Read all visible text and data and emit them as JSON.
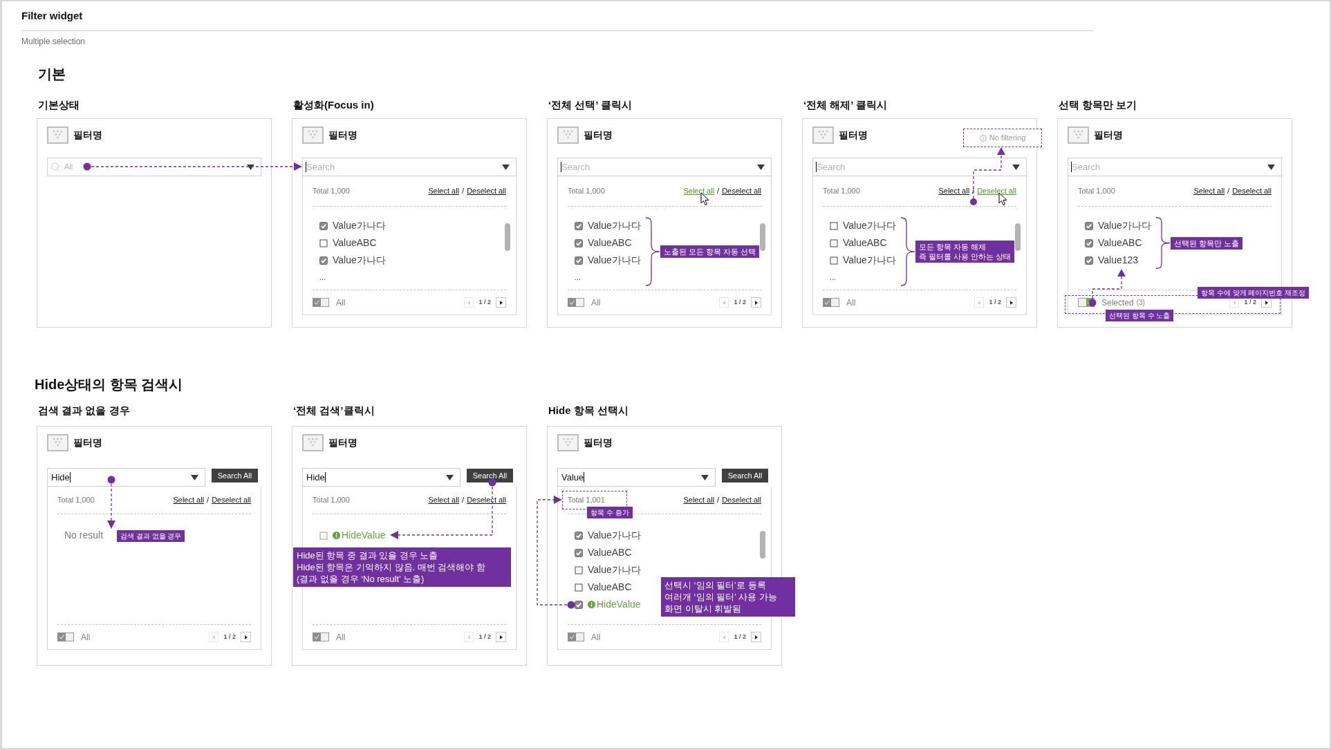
{
  "header": {
    "title": "Filter widget",
    "subtitle": "Multiple selection"
  },
  "sections": [
    {
      "title": "기본",
      "panels": [
        {
          "title": "기본상태",
          "filter_name": "필터명",
          "field": {
            "kind": "idle",
            "placeholder": "All"
          },
          "notes": [
            {
              "kind": "handoff"
            }
          ]
        },
        {
          "title": "활성화(Focus in)",
          "filter_name": "필터명",
          "field": {
            "kind": "focused",
            "placeholder": "Search"
          },
          "list": {
            "total": "Total 1,000",
            "select_all": {
              "label": "Select all",
              "clicked": false
            },
            "separator": "/",
            "deselect_all": {
              "label": "Deselect all",
              "clicked": false
            },
            "items": [
              {
                "label": "Value가나다",
                "checked": true,
                "kind": "regular"
              },
              {
                "label": "ValueABC",
                "checked": false,
                "kind": "regular"
              },
              {
                "label": "Value가나다",
                "checked": true,
                "kind": "regular"
              }
            ],
            "more": "...",
            "scrollbar": true,
            "footer": {
              "selected_only": false,
              "label": "All",
              "pager": {
                "page": "1 / 2",
                "prev_enabled": false,
                "next_enabled": true
              }
            }
          }
        },
        {
          "title": "‘전체 선택’ 클릭시",
          "filter_name": "필터명",
          "field": {
            "kind": "focused",
            "placeholder": "Search"
          },
          "list": {
            "total": "Total 1,000",
            "select_all": {
              "label": "Select all",
              "clicked": true
            },
            "separator": "/",
            "deselect_all": {
              "label": "Deselect all",
              "clicked": false
            },
            "items": [
              {
                "label": "Value가나다",
                "checked": true,
                "kind": "regular"
              },
              {
                "label": "ValueABC",
                "checked": true,
                "kind": "regular"
              },
              {
                "label": "Value가나다",
                "checked": true,
                "kind": "regular"
              }
            ],
            "more": "...",
            "scrollbar": true,
            "footer": {
              "selected_only": false,
              "label": "All",
              "pager": {
                "page": "1 / 2",
                "prev_enabled": false,
                "next_enabled": true
              }
            }
          },
          "notes": [
            {
              "kind": "brace",
              "lines": [
                "노출된 모든 항목 자동 선택"
              ]
            }
          ]
        },
        {
          "title": "‘전체 해제’ 클릭시",
          "filter_name": "필터명",
          "field": {
            "kind": "focused",
            "placeholder": "Search"
          },
          "list": {
            "total": "Total 1,000",
            "select_all": {
              "label": "Select all",
              "clicked": false
            },
            "separator": "/",
            "deselect_all": {
              "label": "Deselect all",
              "clicked": true
            },
            "items": [
              {
                "label": "Value가나다",
                "checked": false,
                "kind": "regular"
              },
              {
                "label": "ValueABC",
                "checked": false,
                "kind": "regular"
              },
              {
                "label": "Value가나다",
                "checked": false,
                "kind": "regular"
              }
            ],
            "more": "...",
            "scrollbar": true,
            "footer": {
              "selected_only": false,
              "label": "All",
              "pager": {
                "page": "1 / 2",
                "prev_enabled": false,
                "next_enabled": true
              }
            }
          },
          "notes": [
            {
              "kind": "no-filtering",
              "text": "No filtering"
            },
            {
              "kind": "brace",
              "lines": [
                "모든 항목 자동 해제",
                "즉 필터를 사용 안하는 상태"
              ]
            }
          ]
        },
        {
          "title": "선택 항목만 보기",
          "filter_name": "필터명",
          "field": {
            "kind": "focused",
            "placeholder": "Search"
          },
          "list": {
            "total": "Total 1,000",
            "select_all": {
              "label": "Select all",
              "clicked": false
            },
            "separator": "/",
            "deselect_all": {
              "label": "Deselect all",
              "clicked": false
            },
            "items": [
              {
                "label": "Value가나다",
                "checked": true,
                "kind": "regular"
              },
              {
                "label": "ValueABC",
                "checked": true,
                "kind": "regular"
              },
              {
                "label": "Value123",
                "checked": true,
                "kind": "regular"
              }
            ],
            "footer": {
              "selected_only": true,
              "label": "Selected",
              "count": "(3)",
              "pager": {
                "page": "1 / 2",
                "prev_enabled": false,
                "next_enabled": true
              }
            }
          },
          "notes": [
            {
              "kind": "brace",
              "lines": [
                "선택된 항목만 노출"
              ]
            },
            {
              "kind": "footer-count",
              "labels": [
                "항목 수에 맞게 페이지번호 재조정",
                "선택된 항목 수 노출"
              ]
            }
          ]
        }
      ]
    },
    {
      "title": "Hide상태의 항목 검색시",
      "panels": [
        {
          "title": "검색 결과 없을 경우",
          "filter_name": "필터명",
          "field": {
            "kind": "focused",
            "value": "Hide"
          },
          "search_all": "Search All",
          "list": {
            "total": "Total 1,000",
            "select_all": {
              "label": "Select all",
              "clicked": false
            },
            "separator": "/",
            "deselect_all": {
              "label": "Deselect all",
              "clicked": false
            },
            "no_result": "No result",
            "footer": {
              "selected_only": false,
              "label": "All",
              "pager": {
                "page": "1 / 2",
                "prev_enabled": false,
                "next_enabled": true
              }
            }
          },
          "notes": [
            {
              "kind": "no-result",
              "label": "검색 결과 없을 경우"
            }
          ]
        },
        {
          "title": "‘전체 검색’클릭시",
          "filter_name": "필터명",
          "field": {
            "kind": "focused",
            "value": "Hide"
          },
          "search_all": "Search All",
          "list": {
            "total": "Total 1,000",
            "select_all": {
              "label": "Select all",
              "clicked": false
            },
            "separator": "/",
            "deselect_all": {
              "label": "Deselect all",
              "clicked": false
            },
            "items": [
              {
                "label": "HideValue",
                "checked": false,
                "kind": "hidden"
              }
            ],
            "footer": {
              "selected_only": false,
              "label": "All",
              "pager": {
                "page": "1 / 2",
                "prev_enabled": false,
                "next_enabled": true
              }
            }
          },
          "notes": [
            {
              "kind": "search-all",
              "lines": [
                "Hide된 항목 중 결과 있을 경우 노출",
                "Hide된 항목은 기억하지 않음. 매번 검색해야 함",
                "(결과 없을 경우 ‘No result’ 노출)"
              ]
            }
          ]
        },
        {
          "title": "Hide 항목 선택시",
          "filter_name": "필터명",
          "field": {
            "kind": "focused",
            "value": "Value"
          },
          "search_all": "Search All",
          "list": {
            "total": "Total 1,001",
            "select_all": {
              "label": "Select all",
              "clicked": false
            },
            "separator": "/",
            "deselect_all": {
              "label": "Deselect all",
              "clicked": false
            },
            "items": [
              {
                "label": "Value가나다",
                "checked": true,
                "kind": "regular"
              },
              {
                "label": "ValueABC",
                "checked": true,
                "kind": "regular"
              },
              {
                "label": "Value가나다",
                "checked": false,
                "kind": "regular"
              },
              {
                "label": "ValueABC",
                "checked": false,
                "kind": "regular"
              },
              {
                "label": "HideValue",
                "checked": true,
                "kind": "hidden"
              }
            ],
            "scrollbar": true,
            "footer": {
              "selected_only": false,
              "label": "All",
              "pager": {
                "page": "1 / 2",
                "prev_enabled": false,
                "next_enabled": true
              }
            }
          },
          "notes": [
            {
              "kind": "hide-select",
              "tag": "항목 수 증가",
              "lines": [
                "선택시 ‘임의 필터’로 등록",
                "여러개 ‘임의 필터’ 사용 가능",
                "화면 이탈시 휘발됨"
              ]
            }
          ]
        }
      ]
    }
  ]
}
